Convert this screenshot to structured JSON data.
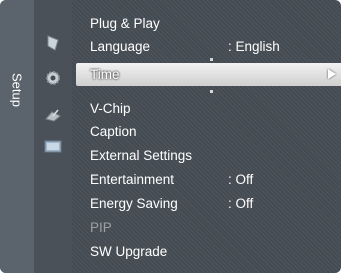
{
  "category": {
    "label": "Setup"
  },
  "icons": [
    {
      "name": "picture-icon"
    },
    {
      "name": "gear-icon"
    },
    {
      "name": "satellite-dish-icon"
    },
    {
      "name": "input-icon"
    }
  ],
  "menu": {
    "items": [
      {
        "label": "Plug & Play",
        "value": ""
      },
      {
        "label": "Language",
        "value": ": English"
      },
      {
        "label": "Time",
        "value": ""
      },
      {
        "label": "V-Chip",
        "value": ""
      },
      {
        "label": "Caption",
        "value": ""
      },
      {
        "label": "External Settings",
        "value": ""
      },
      {
        "label": "Entertainment",
        "value": ": Off"
      },
      {
        "label": "Energy Saving",
        "value": ": Off"
      },
      {
        "label": "PIP",
        "value": ""
      },
      {
        "label": "SW Upgrade",
        "value": ""
      }
    ]
  },
  "colors": {
    "background": "#444b52",
    "highlight": "#e6e6e6",
    "text": "#ffffff",
    "disabled_text": "#9aa0a6"
  }
}
